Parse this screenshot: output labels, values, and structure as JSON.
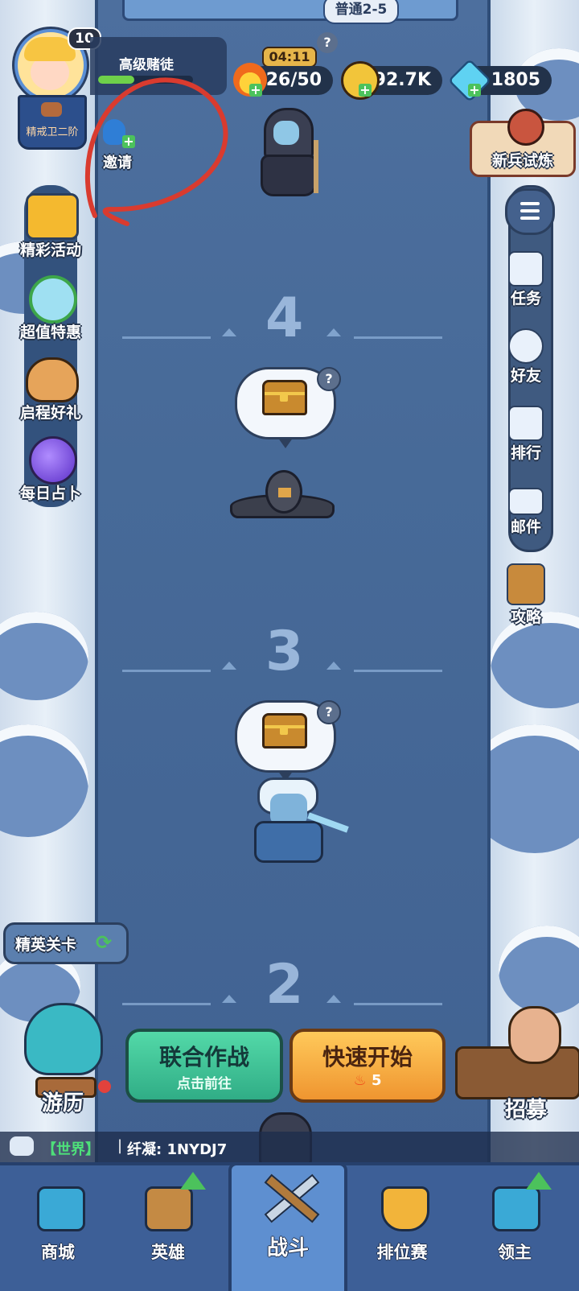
{
  "header": {
    "stage_label": "普通2-5",
    "player": {
      "level": "10",
      "rank_badge": "精戒卫二阶",
      "title": "高级赌徒"
    },
    "invite_label": "邀请",
    "energy": {
      "timer": "04:11",
      "value": "26/50"
    },
    "gold": {
      "value": "92.7K"
    },
    "gems": {
      "value": "1805"
    },
    "newbie_trial_label": "新兵试炼"
  },
  "left_menu": [
    {
      "label": "精彩活动",
      "icon": "treasure-chest-icon"
    },
    {
      "label": "超值特惠",
      "icon": "stopwatch-icon"
    },
    {
      "label": "启程好礼",
      "icon": "bird-icon"
    },
    {
      "label": "每日占卜",
      "icon": "crystal-ball-icon"
    }
  ],
  "right_menu": [
    {
      "label": "任务",
      "icon": "clipboard-icon"
    },
    {
      "label": "好友",
      "icon": "friend-icon"
    },
    {
      "label": "排行",
      "icon": "podium-icon"
    },
    {
      "label": "邮件",
      "icon": "mail-icon"
    },
    {
      "label": "攻略",
      "icon": "guide-book-icon"
    }
  ],
  "floors": [
    {
      "number": "4"
    },
    {
      "number": "3"
    },
    {
      "number": "2"
    }
  ],
  "elite_stage_label": "精英关卡",
  "travel_label": "游历",
  "recruit_label": "招募",
  "coop_button": {
    "title": "联合作战",
    "subtitle": "点击前往"
  },
  "quick_start_button": {
    "title": "快速开始",
    "cost": "5"
  },
  "chat": {
    "channel": "【世界】",
    "separator": "|",
    "message": "纤凝: 1NYDJ7"
  },
  "bottom_nav": [
    {
      "label": "商城"
    },
    {
      "label": "英雄"
    },
    {
      "label": "战斗"
    },
    {
      "label": "排位赛"
    },
    {
      "label": "领主"
    }
  ],
  "colors": {
    "river": "#476a98",
    "coop_green": "#3fc79a",
    "quick_orange": "#f2a23a",
    "nav_bg": "#3d5f97",
    "annotation_red": "#d93b2f"
  }
}
